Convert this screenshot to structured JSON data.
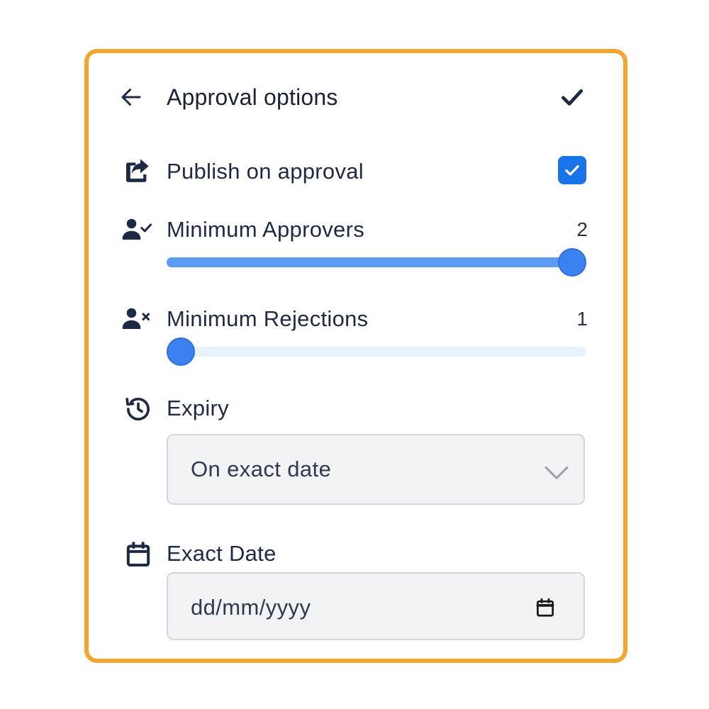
{
  "header": {
    "title": "Approval options",
    "back_icon": "arrow-left-icon",
    "confirm_icon": "check-icon"
  },
  "publish": {
    "label": "Publish on approval",
    "icon": "share-icon",
    "checked": true
  },
  "min_approvers": {
    "label": "Minimum Approvers",
    "icon": "user-check-icon",
    "value": "2",
    "slider_fraction": 1.0
  },
  "min_rejections": {
    "label": "Minimum Rejections",
    "icon": "user-x-icon",
    "value": "1",
    "slider_fraction": 0.0
  },
  "expiry": {
    "label": "Expiry",
    "icon": "history-icon",
    "selected": "On exact date"
  },
  "exact_date": {
    "label": "Exact Date",
    "icon": "calendar-icon",
    "placeholder": "dd/mm/yyyy"
  },
  "colors": {
    "frame": "#f2a62f",
    "accent": "#1a73e8",
    "slider_fill": "#5b9cf2",
    "slider_track": "#e8f1fc",
    "text": "#1e2a44"
  }
}
